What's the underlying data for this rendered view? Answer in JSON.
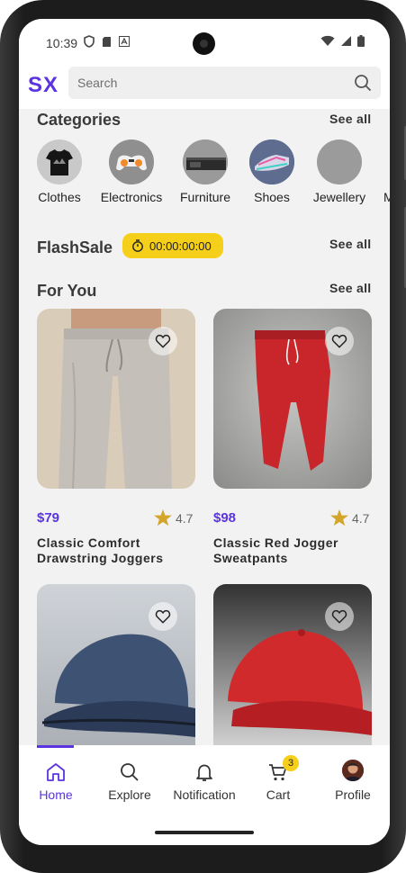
{
  "status_bar": {
    "time": "10:39"
  },
  "app_bar": {
    "logo": "SX",
    "search_placeholder": "Search"
  },
  "categories": {
    "title": "Categories",
    "see_all": "See all",
    "items": [
      {
        "label": "Clothes",
        "icon": "tshirt-icon"
      },
      {
        "label": "Electronics",
        "icon": "gamepad-icon"
      },
      {
        "label": "Furniture",
        "icon": "furniture-icon"
      },
      {
        "label": "Shoes",
        "icon": "shoes-icon"
      },
      {
        "label": "Jewellery",
        "icon": "jewellery-icon"
      },
      {
        "label": "M",
        "icon": "more-category-icon"
      }
    ]
  },
  "flash_sale": {
    "title": "FlashSale",
    "timer": "00:00:00:00",
    "see_all": "See all"
  },
  "for_you": {
    "title": "For You",
    "see_all": "See all",
    "products": [
      {
        "price": "$79",
        "rating": "4.7",
        "name": "Classic Comfort Drawstring Joggers"
      },
      {
        "price": "$98",
        "rating": "4.7",
        "name": "Classic Red Jogger Sweatpants"
      },
      {
        "price": "",
        "rating": "",
        "name": ""
      },
      {
        "price": "",
        "rating": "",
        "name": ""
      }
    ]
  },
  "bottom_nav": {
    "items": [
      {
        "label": "Home",
        "icon": "home-icon",
        "active": true
      },
      {
        "label": "Explore",
        "icon": "search-icon"
      },
      {
        "label": "Notification",
        "icon": "bell-icon"
      },
      {
        "label": "Cart",
        "icon": "cart-icon",
        "badge": "3"
      },
      {
        "label": "Profile",
        "icon": "avatar"
      }
    ]
  },
  "colors": {
    "accent": "#5b33e0",
    "timer_bg": "#f5cf1a",
    "star": "#d4a52a"
  }
}
